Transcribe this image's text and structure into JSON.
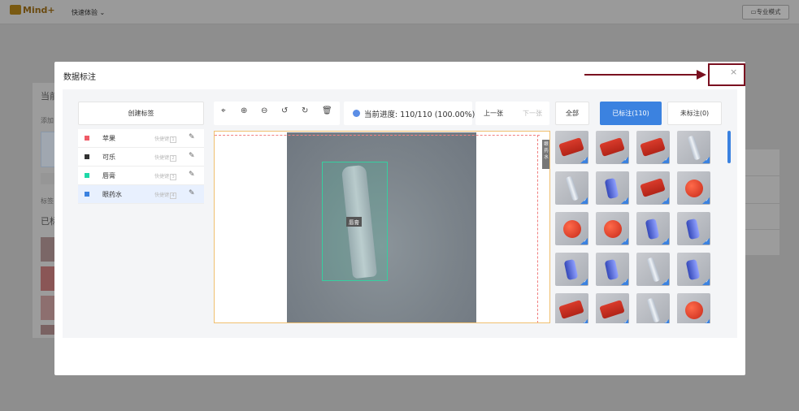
{
  "app": {
    "logo_text": "Mind+",
    "mode_menu": "快速体验",
    "pro_mode_button": "专业模式"
  },
  "background": {
    "title_partial": "当前",
    "add_partial": "添加",
    "labels_partial": "标签",
    "labeled_partial": "已标"
  },
  "modal": {
    "title": "数据标注",
    "close_symbol": "×"
  },
  "labels_panel": {
    "create_button": "创建标签",
    "hotkey_text": "快捷键",
    "items": [
      {
        "name": "苹果",
        "hotkey": "1",
        "color": "#ef5b67"
      },
      {
        "name": "可乐",
        "hotkey": "2",
        "color": "#333333"
      },
      {
        "name": "唇膏",
        "hotkey": "3",
        "color": "#1ed9a8"
      },
      {
        "name": "眼药水",
        "hotkey": "4",
        "color": "#3b82e0",
        "active": true
      }
    ]
  },
  "toolbar": {
    "icons": [
      "crosshair-icon",
      "zoom-in-icon",
      "zoom-out-icon",
      "rotate-left-icon",
      "rotate-right-icon",
      "delete-icon"
    ]
  },
  "progress": {
    "label": "当前进度: 110/110 (100.00%)",
    "completed": 110,
    "total": 110
  },
  "navigation": {
    "prev": "上一张",
    "next": "下一张"
  },
  "filters": {
    "all": "全部",
    "labeled": "已标注(110)",
    "unlabeled": "未标注(0)"
  },
  "canvas": {
    "bbox_label": "唇膏",
    "side_label": "眼药水"
  },
  "accent_color": "#3b82e0"
}
